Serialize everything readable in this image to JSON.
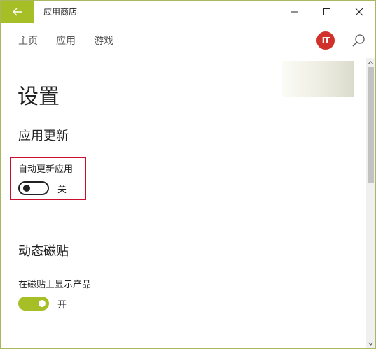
{
  "window": {
    "title": "应用商店",
    "accent_color": "#a6bf27",
    "back_icon": "arrow-left-icon",
    "controls": [
      "minimize-icon",
      "maximize-icon",
      "close-icon"
    ]
  },
  "nav": {
    "items": [
      "主页",
      "应用",
      "游戏"
    ],
    "avatar_text": "IT",
    "avatar_color": "#d0322b",
    "search_icon": "search-icon"
  },
  "page": {
    "title": "设置"
  },
  "sections": [
    {
      "title": "应用更新",
      "setting_label": "自动更新应用",
      "toggle_on": false,
      "toggle_state": "关"
    },
    {
      "title": "动态磁贴",
      "setting_label": "在磁贴上显示产品",
      "toggle_on": true,
      "toggle_state": "开"
    }
  ],
  "highlight_color": "#c8102e"
}
